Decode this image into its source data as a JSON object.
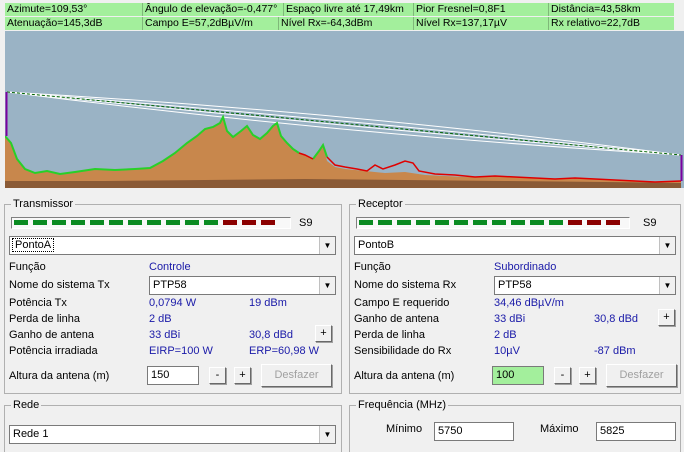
{
  "status": {
    "azimute": "Azimute=109,53°",
    "angulo": "Ângulo de elevação=-0,477°",
    "espaco": "Espaço livre até 17,49km",
    "fresnel": "Pior Fresnel=0,8F1",
    "distancia": "Distância=43,58km",
    "atenuacao": "Atenuação=145,3dB",
    "campo": "Campo E=57,2dBµV/m",
    "nivel": "Nível Rx=-64,3dBm",
    "nivel_rx": "Nível Rx=137,17µV",
    "rx_relativo": "Rx relativo=22,7dB"
  },
  "transmitter": {
    "title": "Transmissor",
    "meter_label": "S9",
    "site": "PontoA",
    "funcao_label": "Função",
    "funcao_value": "Controle",
    "sistema_label": "Nome do sistema Tx",
    "sistema_value": "PTP58",
    "potencia_label": "Potência Tx",
    "potencia_w": "0,0794 W",
    "potencia_dbm": "19 dBm",
    "perda_label": "Perda de linha",
    "perda_value": "2 dB",
    "ganho_label": "Ganho de antena",
    "ganho_dbi": "33 dBi",
    "ganho_dbd": "30,8 dBd",
    "plus": "+",
    "irradiada_label": "Potência irradiada",
    "eirp": "EIRP=100 W",
    "erp": "ERP=60,98 W",
    "altura_label": "Altura da antena (m)",
    "altura_value": "150",
    "minus_btn": "-",
    "plus_btn": "+",
    "desfazer": "Desfazer"
  },
  "receiver": {
    "title": "Receptor",
    "meter_label": "S9",
    "site": "PontoB",
    "funcao_label": "Função",
    "funcao_value": "Subordinado",
    "sistema_label": "Nome do sistema Rx",
    "sistema_value": "PTP58",
    "campo_label": "Campo E requerido",
    "campo_value": "34,46 dBµV/m",
    "ganho_label": "Ganho de antena",
    "ganho_dbi": "33 dBi",
    "ganho_dbd": "30,8 dBd",
    "plus": "+",
    "perda_label": "Perda de linha",
    "perda_value": "2 dB",
    "sens_label": "Sensibilidade do Rx",
    "sens_uv": "10µV",
    "sens_dbm": "-87 dBm",
    "altura_label": "Altura da antena (m)",
    "altura_value": "100",
    "minus_btn": "-",
    "plus_btn": "+",
    "desfazer": "Desfazer"
  },
  "rede": {
    "title": "Rede",
    "value": "Rede  1"
  },
  "frequencia": {
    "title": "Frequência (MHz)",
    "min_label": "Mínimo",
    "min_value": "5750",
    "max_label": "Máximo",
    "max_value": "5825"
  },
  "colors": {
    "status_green": "#a3ef9c",
    "sky": "#9ab3c5",
    "terrain": "#c8874c",
    "los_line_green": "#00a000",
    "terrain_profile_red": "#e00000",
    "meter_green": "#0b8b22",
    "meter_red": "#8b0000",
    "value_blue": "#1a1aa8"
  }
}
